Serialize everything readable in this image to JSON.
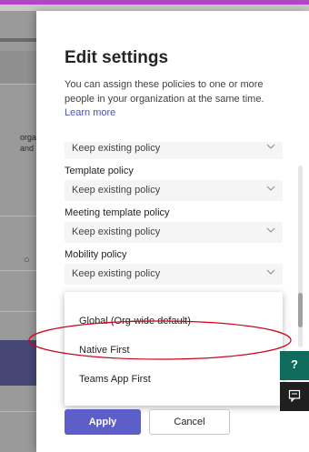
{
  "panel": {
    "title": "Edit settings",
    "description": "You can assign these policies to one or more people in your organization at the same time.",
    "learn_more": "Learn more"
  },
  "background": {
    "text_line_1": "organ",
    "text_line_2": "and a"
  },
  "fields": [
    {
      "label": "",
      "value": "Keep existing policy"
    },
    {
      "label": "Template policy",
      "value": "Keep existing policy"
    },
    {
      "label": "Meeting template policy",
      "value": "Keep existing policy"
    },
    {
      "label": "Mobility policy",
      "value": "Keep existing policy"
    }
  ],
  "dropdown": {
    "options": [
      "Global (Org-wide default)",
      "Native First",
      "Teams App First"
    ],
    "highlighted": "Native First"
  },
  "footer": {
    "apply_label": "Apply",
    "cancel_label": "Cancel"
  },
  "colors": {
    "primary": "#5b5fc7",
    "annotation": "#d0021b",
    "help": "#0f6c5c"
  },
  "icons": {
    "help": "help-icon",
    "feedback": "feedback-icon",
    "chevron": "chevron-down-icon"
  }
}
